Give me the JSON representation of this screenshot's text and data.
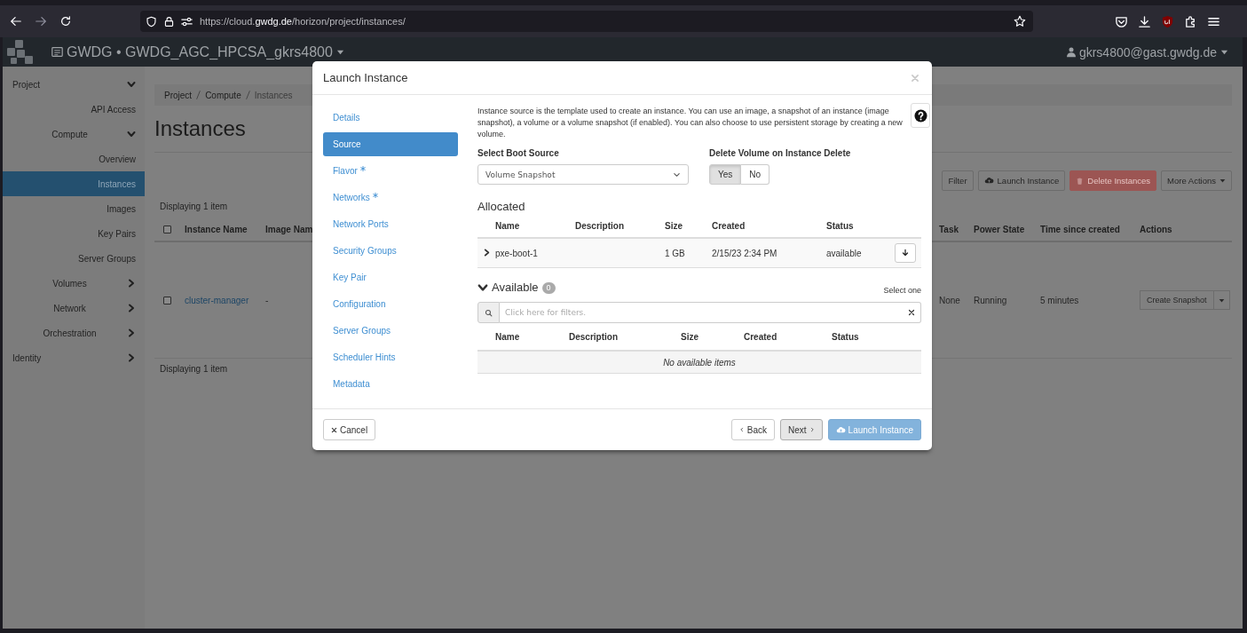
{
  "browser": {
    "url": "https://cloud.**gwdg.de**/horizon/project/instances/"
  },
  "navbar": {
    "project": "GWDG • GWDG_AGC_HPCSA_gkrs4800",
    "user": "gkrs4800@gast.gwdg.de"
  },
  "sidebar": {
    "items": [
      {
        "label": "Project",
        "expanded": true,
        "children": [
          {
            "label": "API Access",
            "selected": false
          },
          {
            "label": "Compute",
            "expanded": true,
            "children": [
              {
                "label": "Overview",
                "selected": false
              },
              {
                "label": "Instances",
                "selected": true
              },
              {
                "label": "Images",
                "selected": false
              },
              {
                "label": "Key Pairs",
                "selected": false
              },
              {
                "label": "Server Groups",
                "selected": false
              }
            ]
          },
          {
            "label": "Volumes",
            "expanded": false
          },
          {
            "label": "Network",
            "expanded": false
          },
          {
            "label": "Orchestration",
            "expanded": false
          }
        ]
      },
      {
        "label": "Identity",
        "expanded": false
      }
    ]
  },
  "breadcrumb": [
    "Project",
    "Compute",
    "Instances"
  ],
  "page": {
    "title": "Instances",
    "count_top": "Displaying 1 item",
    "count_bottom": "Displaying 1 item"
  },
  "toolbar": [
    {
      "label": "Filter",
      "kind": "plain",
      "disabled": false
    },
    {
      "label": "Launch Instance",
      "kind": "launch",
      "disabled": false
    },
    {
      "label": "Delete Instances",
      "kind": "danger",
      "disabled": true
    },
    {
      "label": "More Actions",
      "kind": "menu",
      "disabled": false
    }
  ],
  "table": {
    "columns": [
      {
        "kind": "checkbox",
        "checked": false
      },
      {
        "label": "Instance Name"
      },
      {
        "label": "Image Nam"
      },
      {
        "label": "Task"
      },
      {
        "label": "Power State"
      },
      {
        "label": "Time since created"
      },
      {
        "label": "Actions"
      }
    ],
    "rows": [
      {
        "cells": [
          {
            "kind": "checkbox",
            "checked": false
          },
          {
            "kind": "link",
            "text": "cluster-manager"
          },
          {
            "text": "-"
          },
          {
            "text": "None"
          },
          {
            "text": "Running"
          },
          {
            "text": "5 minutes"
          },
          {
            "kind": "action",
            "text": "Create Snapshot"
          }
        ]
      }
    ]
  },
  "modal": {
    "title": "Launch Instance",
    "steps": [
      {
        "label": "Details",
        "selected": false,
        "required": false
      },
      {
        "label": "Source",
        "selected": true,
        "required": false
      },
      {
        "label": "Flavor",
        "selected": false,
        "required": true
      },
      {
        "label": "Networks",
        "selected": false,
        "required": true
      },
      {
        "label": "Network Ports",
        "selected": false,
        "required": false
      },
      {
        "label": "Security Groups",
        "selected": false,
        "required": false
      },
      {
        "label": "Key Pair",
        "selected": false,
        "required": false
      },
      {
        "label": "Configuration",
        "selected": false,
        "required": false
      },
      {
        "label": "Server Groups",
        "selected": false,
        "required": false
      },
      {
        "label": "Scheduler Hints",
        "selected": false,
        "required": false
      },
      {
        "label": "Metadata",
        "selected": false,
        "required": false
      }
    ],
    "help": "Instance source is the template used to create an instance. You can use an image, a snapshot of an instance (image snapshot), a volume or a volume snapshot (if enabled). You can also choose to use persistent storage by creating a new volume.",
    "boot_source": {
      "label": "Select Boot Source",
      "value": "Volume Snapshot"
    },
    "delete_volume": {
      "label": "Delete Volume on Instance Delete",
      "options": [
        {
          "label": "Yes",
          "selected": true
        },
        {
          "label": "No",
          "selected": false
        }
      ]
    },
    "allocated": {
      "title": "Allocated",
      "columns": [
        "Name",
        "Description",
        "Size",
        "Created",
        "Status"
      ],
      "rows": [
        {
          "name": "pxe-boot-1",
          "size": "1 GB",
          "created": "2/15/23 2:34 PM",
          "status": "available",
          "expanded": false
        }
      ]
    },
    "available": {
      "title": "Available",
      "count": "0",
      "expanded": true,
      "hint": "Select one",
      "filter": {
        "placeholder": "Click here for filters."
      },
      "columns": [
        "Name",
        "Description",
        "Size",
        "Created",
        "Status"
      ],
      "empty": "No available items"
    },
    "footer": [
      {
        "label": "Cancel",
        "kind": "cancel",
        "disabled": false
      },
      {
        "label": "Back",
        "kind": "back",
        "disabled": false
      },
      {
        "label": "Next",
        "kind": "next",
        "disabled": false
      },
      {
        "label": "Launch Instance",
        "kind": "launch",
        "disabled": true
      }
    ]
  }
}
